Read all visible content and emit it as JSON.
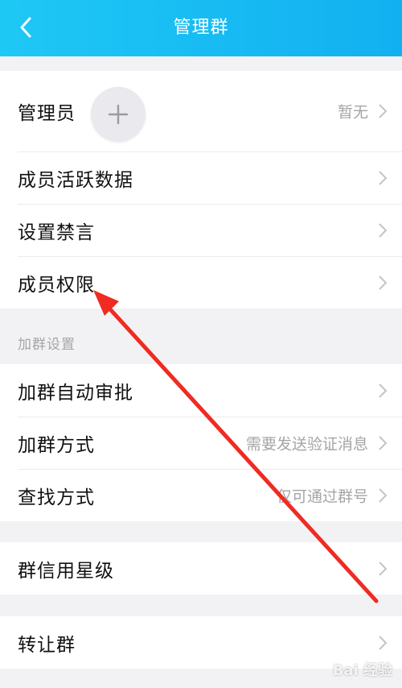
{
  "header": {
    "title": "管理群"
  },
  "group1": [
    {
      "label": "管理员",
      "value": "暂无"
    },
    {
      "label": "成员活跃数据",
      "value": ""
    },
    {
      "label": "设置禁言",
      "value": ""
    },
    {
      "label": "成员权限",
      "value": ""
    }
  ],
  "join_section": {
    "title": "加群设置"
  },
  "group2": [
    {
      "label": "加群自动审批",
      "value": ""
    },
    {
      "label": "加群方式",
      "value": "需要发送验证消息"
    },
    {
      "label": "查找方式",
      "value": "仅可通过群号"
    }
  ],
  "group3": [
    {
      "label": "群信用星级",
      "value": ""
    }
  ],
  "group4": [
    {
      "label": "转让群",
      "value": ""
    }
  ],
  "watermark": "Bai 经验",
  "colors": {
    "header": "#1ec8f5",
    "arrow": "#ef2b22",
    "chevron": "#c4c4c4"
  }
}
